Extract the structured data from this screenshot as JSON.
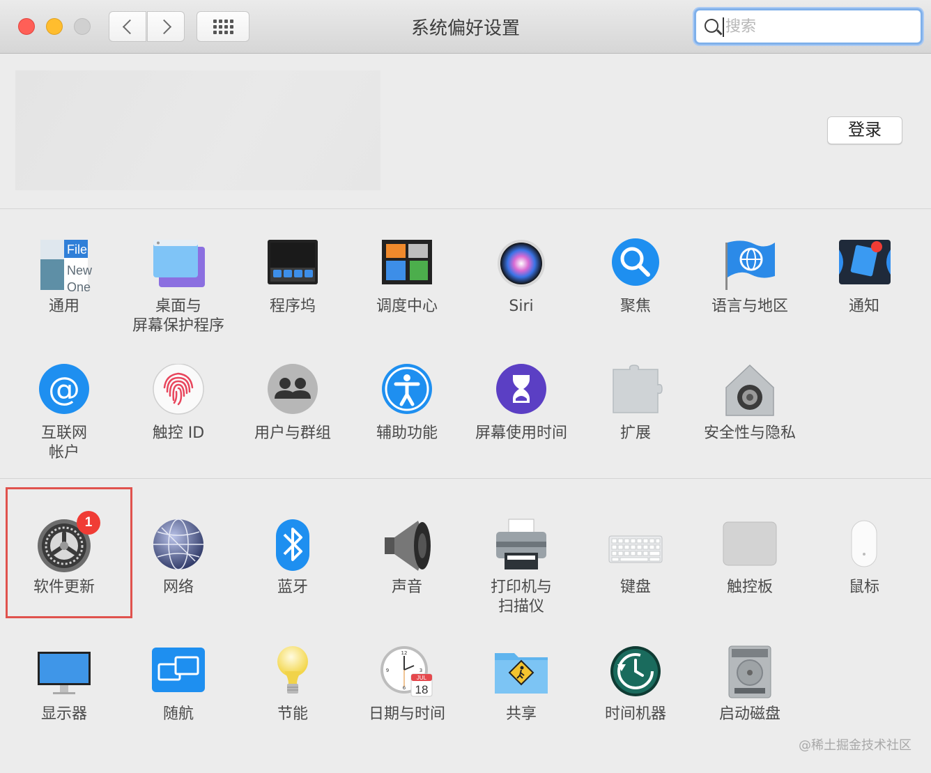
{
  "window": {
    "title": "系统偏好设置",
    "search_placeholder": "搜索"
  },
  "account": {
    "login_label": "登录"
  },
  "sections": [
    [
      {
        "label": "通用",
        "icon": "general-icon"
      },
      {
        "label": "桌面与\n屏幕保护程序",
        "icon": "desktop-screensaver-icon"
      },
      {
        "label": "程序坞",
        "icon": "dock-icon"
      },
      {
        "label": "调度中心",
        "icon": "mission-control-icon"
      },
      {
        "label": "Siri",
        "icon": "siri-icon"
      },
      {
        "label": "聚焦",
        "icon": "spotlight-icon"
      },
      {
        "label": "语言与地区",
        "icon": "language-region-icon"
      },
      {
        "label": "通知",
        "icon": "notifications-icon"
      },
      {
        "label": "互联网\n帐户",
        "icon": "internet-accounts-icon"
      },
      {
        "label": "触控 ID",
        "icon": "touch-id-icon"
      },
      {
        "label": "用户与群组",
        "icon": "users-groups-icon"
      },
      {
        "label": "辅助功能",
        "icon": "accessibility-icon"
      },
      {
        "label": "屏幕使用时间",
        "icon": "screen-time-icon"
      },
      {
        "label": "扩展",
        "icon": "extensions-icon"
      },
      {
        "label": "安全性与隐私",
        "icon": "security-privacy-icon"
      }
    ],
    [
      {
        "label": "软件更新",
        "icon": "software-update-icon",
        "badge": "1",
        "highlighted": true
      },
      {
        "label": "网络",
        "icon": "network-icon"
      },
      {
        "label": "蓝牙",
        "icon": "bluetooth-icon"
      },
      {
        "label": "声音",
        "icon": "sound-icon"
      },
      {
        "label": "打印机与\n扫描仪",
        "icon": "printers-scanners-icon"
      },
      {
        "label": "键盘",
        "icon": "keyboard-icon"
      },
      {
        "label": "触控板",
        "icon": "trackpad-icon"
      },
      {
        "label": "鼠标",
        "icon": "mouse-icon"
      },
      {
        "label": "显示器",
        "icon": "displays-icon"
      },
      {
        "label": "随航",
        "icon": "sidecar-icon"
      },
      {
        "label": "节能",
        "icon": "energy-saver-icon"
      },
      {
        "label": "日期与时间",
        "icon": "date-time-icon"
      },
      {
        "label": "共享",
        "icon": "sharing-icon"
      },
      {
        "label": "时间机器",
        "icon": "time-machine-icon"
      },
      {
        "label": "启动磁盘",
        "icon": "startup-disk-icon"
      }
    ]
  ],
  "icon_text": {
    "general": [
      "File",
      "New",
      "One"
    ],
    "calendar_month": "JUL",
    "calendar_day": "18"
  },
  "watermark": "@稀土掘金技术社区"
}
